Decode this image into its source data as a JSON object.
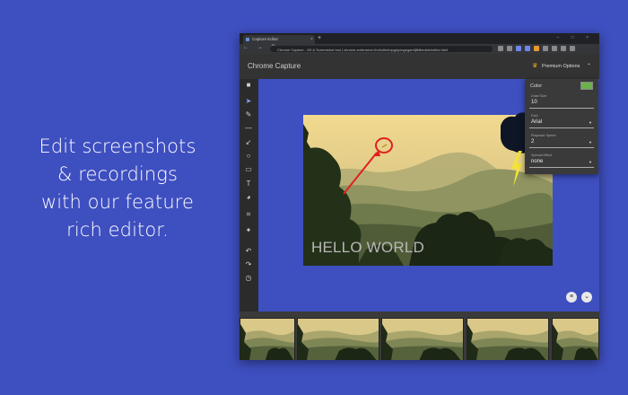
{
  "promo": {
    "lines": [
      "Edit screenshots",
      "& recordings",
      "with our feature",
      "rich editor."
    ]
  },
  "browser": {
    "tab_title": "Capture Editor",
    "tab_close": "×",
    "new_tab": "+",
    "window_controls": "– □ ×",
    "nav_buttons": "← → C",
    "url": "Chrome Capture - Gif & Screenshot tool | chrome-extension://ncfcdhnlmpgnjcmgegamfjfkfbedcle/editor.html"
  },
  "app": {
    "title": "Chrome Capture",
    "premium_label": "Premium Options",
    "crown_icon": "♛",
    "collapse_icon": "⌃"
  },
  "tools": [
    {
      "name": "save-icon",
      "glyph": "■"
    },
    {
      "name": "select-icon",
      "glyph": "➤"
    },
    {
      "name": "pen-icon",
      "glyph": "✎"
    },
    {
      "name": "line-icon",
      "glyph": "—"
    },
    {
      "name": "arrow-icon",
      "glyph": "↙"
    },
    {
      "name": "circle-icon",
      "glyph": "○"
    },
    {
      "name": "rectangle-icon",
      "glyph": "▭"
    },
    {
      "name": "text-icon",
      "glyph": "T"
    },
    {
      "name": "blur-icon",
      "glyph": "◕"
    },
    {
      "name": "crop-icon",
      "glyph": "⌗"
    },
    {
      "name": "highlight-icon",
      "glyph": "✦"
    },
    {
      "name": "undo-icon",
      "glyph": "↶"
    },
    {
      "name": "redo-icon",
      "glyph": "↷"
    },
    {
      "name": "history-icon",
      "glyph": "◷"
    }
  ],
  "canvas": {
    "overlay_text": "HELLO WORLD"
  },
  "options": {
    "color_label": "Color",
    "color_value": "#6db14c",
    "fields": [
      {
        "label": "Draw Size",
        "value": "10",
        "dropdown": false
      },
      {
        "label": "Font",
        "value": "Arial",
        "dropdown": true
      },
      {
        "label": "Playback Speed",
        "value": "2",
        "dropdown": true
      },
      {
        "label": "Special Effect",
        "value": "none",
        "dropdown": true
      }
    ]
  },
  "fabs": {
    "menu_glyph": "≡",
    "expand_glyph": "⌄"
  },
  "filmstrip": {
    "frame_count": 5
  }
}
